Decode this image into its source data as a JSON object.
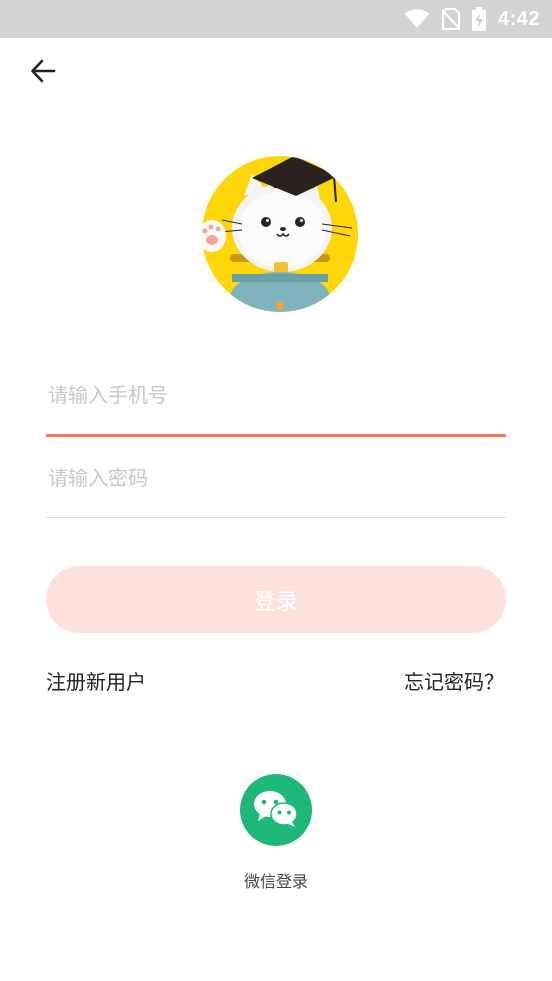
{
  "status_bar": {
    "time": "4:42",
    "icons": [
      "wifi-icon",
      "no-sim-icon",
      "battery-charging-icon"
    ]
  },
  "header": {
    "back_icon": "arrow-left-icon"
  },
  "avatar": {
    "description_icon": "cat-graduate-avatar"
  },
  "form": {
    "phone_placeholder": "请输入手机号",
    "phone_value": "",
    "password_placeholder": "请输入密码",
    "password_value": "",
    "login_label": "登录"
  },
  "links": {
    "register_label": "注册新用户",
    "forgot_label": "忘记密码？"
  },
  "social": {
    "wechat_label": "微信登录",
    "wechat_icon": "wechat-icon"
  },
  "colors": {
    "accent": "#ef7a5a",
    "login_button_bg": "#fde2dc",
    "wechat_green": "#1eb978",
    "avatar_yellow": "#ffd60a"
  }
}
